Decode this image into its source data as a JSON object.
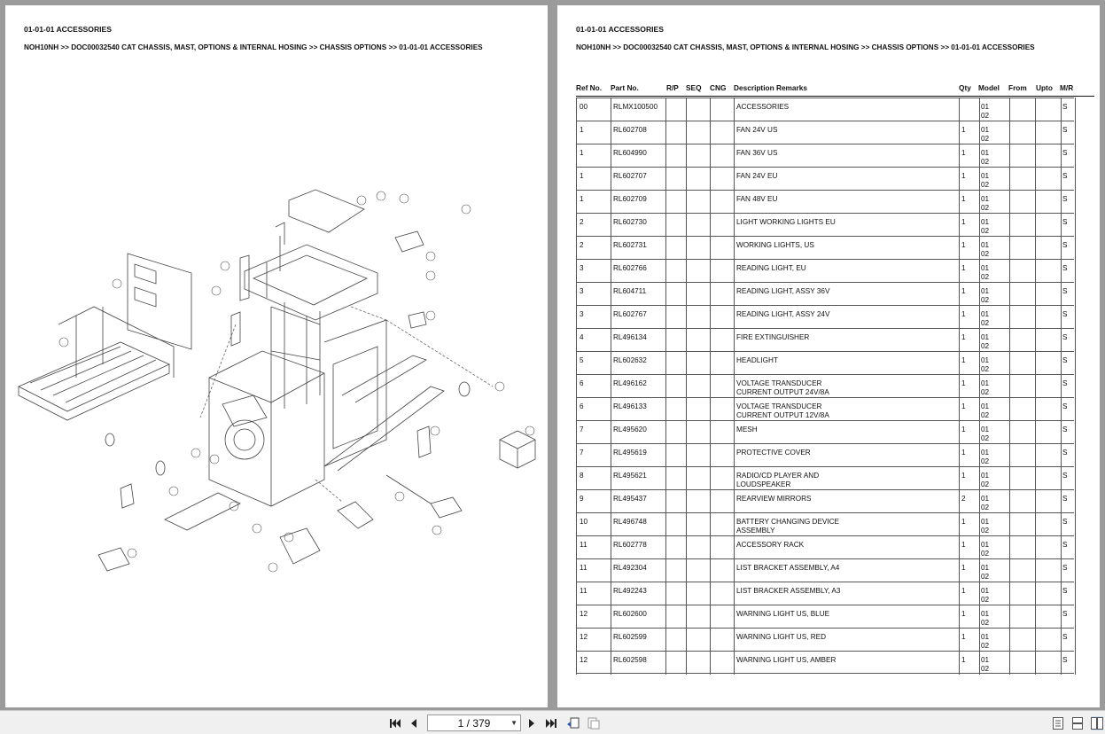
{
  "section_title": "01-01-01 ACCESSORIES",
  "breadcrumb": "NOH10NH >> DOC00032540 CAT CHASSIS, MAST, OPTIONS & INTERNAL HOSING >> CHASSIS OPTIONS >> 01-01-01 ACCESSORIES",
  "diagram_callouts": [
    "7",
    "13",
    "9",
    "1",
    "18",
    "7",
    "12",
    "6",
    "3",
    "4",
    "11",
    "2",
    "10",
    "4",
    "20",
    "19",
    "5",
    "8",
    "17",
    "14",
    "15",
    "16",
    "19",
    "14"
  ],
  "table": {
    "headers": {
      "ref": "Ref No.",
      "part": "Part No.",
      "rp": "R/P",
      "seq": "SEQ",
      "cng": "CNG",
      "desc": "Description Remarks",
      "qty": "Qty",
      "model": "Model",
      "from": "From",
      "upto": "Upto",
      "mr": "M/R"
    },
    "rows": [
      {
        "ref": "00",
        "part": "RLMX100500",
        "desc1": "ACCESSORIES",
        "desc2": "",
        "qty": "",
        "m1": "01",
        "m2": "02",
        "mr": "S"
      },
      {
        "ref": "1",
        "part": "RL602708",
        "desc1": "FAN 24V US",
        "desc2": "",
        "qty": "1",
        "m1": "01",
        "m2": "02",
        "mr": "S"
      },
      {
        "ref": "1",
        "part": "RL604990",
        "desc1": "FAN 36V US",
        "desc2": "",
        "qty": "1",
        "m1": "01",
        "m2": "02",
        "mr": "S"
      },
      {
        "ref": "1",
        "part": "RL602707",
        "desc1": "FAN 24V EU",
        "desc2": "",
        "qty": "1",
        "m1": "01",
        "m2": "02",
        "mr": "S"
      },
      {
        "ref": "1",
        "part": "RL602709",
        "desc1": "FAN 48V EU",
        "desc2": "",
        "qty": "1",
        "m1": "01",
        "m2": "02",
        "mr": "S"
      },
      {
        "ref": "2",
        "part": "RL602730",
        "desc1": "LIGHT WORKING LIGHTS EU",
        "desc2": "",
        "qty": "1",
        "m1": "01",
        "m2": "02",
        "mr": "S"
      },
      {
        "ref": "2",
        "part": "RL602731",
        "desc1": "WORKING LIGHTS, US",
        "desc2": "",
        "qty": "1",
        "m1": "01",
        "m2": "02",
        "mr": "S"
      },
      {
        "ref": "3",
        "part": "RL602766",
        "desc1": "READING LIGHT, EU",
        "desc2": "",
        "qty": "1",
        "m1": "01",
        "m2": "02",
        "mr": "S"
      },
      {
        "ref": "3",
        "part": "RL604711",
        "desc1": "READING LIGHT, ASSY 36V",
        "desc2": "",
        "qty": "1",
        "m1": "01",
        "m2": "02",
        "mr": "S"
      },
      {
        "ref": "3",
        "part": "RL602767",
        "desc1": "READING LIGHT, ASSY 24V",
        "desc2": "",
        "qty": "1",
        "m1": "01",
        "m2": "02",
        "mr": "S"
      },
      {
        "ref": "4",
        "part": "RL496134",
        "desc1": "FIRE EXTINGUISHER",
        "desc2": "",
        "qty": "1",
        "m1": "01",
        "m2": "02",
        "mr": "S"
      },
      {
        "ref": "5",
        "part": "RL602632",
        "desc1": "HEADLIGHT",
        "desc2": "",
        "qty": "1",
        "m1": "01",
        "m2": "02",
        "mr": "S"
      },
      {
        "ref": "6",
        "part": "RL496162",
        "desc1": "VOLTAGE TRANSDUCER",
        "desc2": "CURRENT OUTPUT 24V/8A",
        "qty": "1",
        "m1": "01",
        "m2": "02",
        "mr": "S"
      },
      {
        "ref": "6",
        "part": "RL496133",
        "desc1": "VOLTAGE TRANSDUCER",
        "desc2": "CURRENT OUTPUT 12V/8A",
        "qty": "1",
        "m1": "01",
        "m2": "02",
        "mr": "S"
      },
      {
        "ref": "7",
        "part": "RL495620",
        "desc1": "MESH",
        "desc2": "",
        "qty": "1",
        "m1": "01",
        "m2": "02",
        "mr": "S"
      },
      {
        "ref": "7",
        "part": "RL495619",
        "desc1": "PROTECTIVE COVER",
        "desc2": "",
        "qty": "1",
        "m1": "01",
        "m2": "02",
        "mr": "S"
      },
      {
        "ref": "8",
        "part": "RL495621",
        "desc1": "RADIO/CD PLAYER AND",
        "desc2": "LOUDSPEAKER",
        "qty": "1",
        "m1": "01",
        "m2": "02",
        "mr": "S"
      },
      {
        "ref": "9",
        "part": "RL495437",
        "desc1": "REARVIEW MIRRORS",
        "desc2": "",
        "qty": "2",
        "m1": "01",
        "m2": "02",
        "mr": "S"
      },
      {
        "ref": "10",
        "part": "RL496748",
        "desc1": "BATTERY CHANGING DEVICE",
        "desc2": "ASSEMBLY",
        "qty": "1",
        "m1": "01",
        "m2": "02",
        "mr": "S"
      },
      {
        "ref": "11",
        "part": "RL602778",
        "desc1": "ACCESSORY RACK",
        "desc2": "",
        "qty": "1",
        "m1": "01",
        "m2": "02",
        "mr": "S"
      },
      {
        "ref": "11",
        "part": "RL492304",
        "desc1": "LIST BRACKET ASSEMBLY, A4",
        "desc2": "",
        "qty": "1",
        "m1": "01",
        "m2": "02",
        "mr": "S"
      },
      {
        "ref": "11",
        "part": "RL492243",
        "desc1": "LIST BRACKER ASSEMBLY, A3",
        "desc2": "",
        "qty": "1",
        "m1": "01",
        "m2": "02",
        "mr": "S"
      },
      {
        "ref": "12",
        "part": "RL602600",
        "desc1": "WARNING LIGHT US, BLUE",
        "desc2": "",
        "qty": "1",
        "m1": "01",
        "m2": "02",
        "mr": "S"
      },
      {
        "ref": "12",
        "part": "RL602599",
        "desc1": "WARNING LIGHT US, RED",
        "desc2": "",
        "qty": "1",
        "m1": "01",
        "m2": "02",
        "mr": "S"
      },
      {
        "ref": "12",
        "part": "RL602598",
        "desc1": "WARNING LIGHT US, AMBER",
        "desc2": "",
        "qty": "1",
        "m1": "01",
        "m2": "02",
        "mr": "S"
      }
    ]
  },
  "toolbar": {
    "page_indicator": "1 / 379",
    "first_icon": "first-page-icon",
    "prev_icon": "previous-page-icon",
    "next_icon": "next-page-icon",
    "last_icon": "last-page-icon"
  },
  "colors": {
    "background": "#9b9b9b",
    "page": "#ffffff",
    "toolbar": "#f0f0f0"
  }
}
